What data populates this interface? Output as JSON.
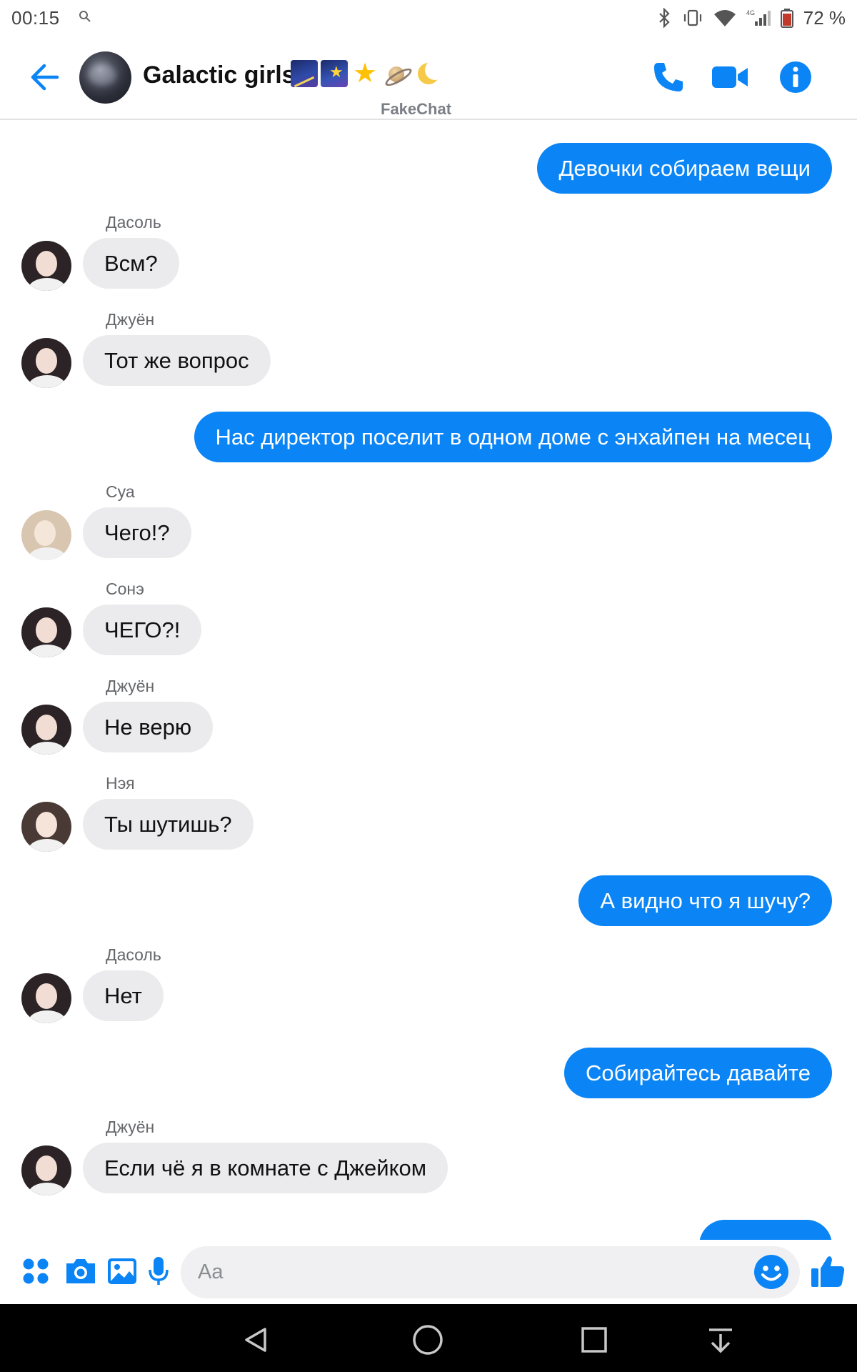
{
  "status_bar": {
    "time": "00:15",
    "battery": "72 %"
  },
  "header": {
    "title": "Galactic girls",
    "title_emojis": [
      "night-with-stars",
      "milky-way",
      "star",
      "ringed-planet",
      "crescent-moon"
    ],
    "watermark": "FakeChat",
    "accent_color": "#0b85f5"
  },
  "messages": [
    {
      "direction": "out",
      "text": "Девочки собираем вещи"
    },
    {
      "direction": "in",
      "sender": "Дасоль",
      "text": "Всм?"
    },
    {
      "direction": "in",
      "sender": "Джуён",
      "text": "Тот же вопрос"
    },
    {
      "direction": "out",
      "text": "Нас директор поселит в одном доме с энхайпен на месец"
    },
    {
      "direction": "in",
      "sender": "Суа",
      "text": "Чего!?"
    },
    {
      "direction": "in",
      "sender": "Сонэ",
      "text": "ЧЕГО?!"
    },
    {
      "direction": "in",
      "sender": "Джуён",
      "text": "Не верю"
    },
    {
      "direction": "in",
      "sender": "Нэя",
      "text": "Ты шутишь?"
    },
    {
      "direction": "out",
      "text": "А видно что я шучу?"
    },
    {
      "direction": "in",
      "sender": "Дасоль",
      "text": "Нет"
    },
    {
      "direction": "out",
      "text": "Собирайтесь давайте"
    },
    {
      "direction": "in",
      "sender": "Джуён",
      "text": "Если чё я в комнате с Джейком"
    }
  ],
  "composer": {
    "placeholder": "Aa",
    "value": ""
  },
  "colors": {
    "outgoing_bubble": "#0b85f5",
    "incoming_bubble": "#ebebed",
    "icon_blue": "#0b85f5"
  }
}
